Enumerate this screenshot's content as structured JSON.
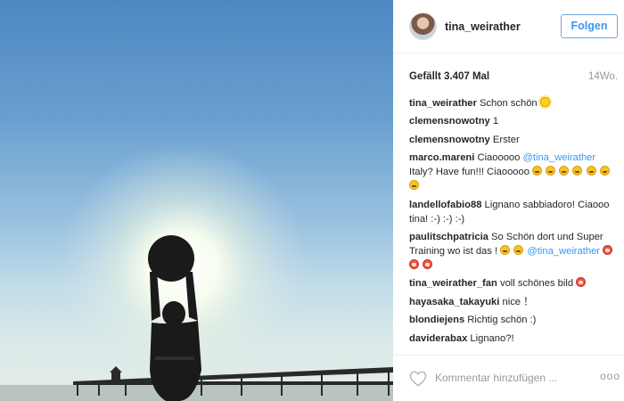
{
  "post": {
    "username": "tina_weirather",
    "follow_label": "Folgen",
    "likes_text": "Gefällt 3.407 Mal",
    "time_text": "14Wo."
  },
  "comments": [
    {
      "user": "tina_weirather",
      "text": "Schon schön"
    },
    {
      "user": "clemensnowotny",
      "text": "1"
    },
    {
      "user": "clemensnowotny",
      "text": "Erster"
    },
    {
      "user": "marco.mareni",
      "text": "Ciaooooo",
      "mention": "@tina_weirather",
      "text2": "Italy? Have fun!!! Ciaooooo"
    },
    {
      "user": "landellofabio88",
      "text": "Lignano sabbiadoro! Ciaooo tina! :-) :-) :-)"
    },
    {
      "user": "paulitschpatricia",
      "text": "So Schön dort und Super Training wo ist das !",
      "mention": "@tina_weirather"
    },
    {
      "user": "tina_weirather_fan",
      "text": "voll schönes bild"
    },
    {
      "user": "hayasaka_takayuki",
      "text": "nice ！"
    },
    {
      "user": "blondiejens",
      "text": "Richtig schön :)"
    },
    {
      "user": "daviderabax",
      "text": "Lignano?!"
    }
  ],
  "footer": {
    "add_comment_placeholder": "Kommentar hinzufügen ...",
    "more_label": "ooo"
  },
  "icons": {
    "like": "heart-outline-icon",
    "more": "more-options-icon",
    "emoji_sun": "sun-emoji-icon",
    "emoji_face": "smiley-emoji-icon",
    "emoji_heart": "heart-eyes-emoji-icon"
  },
  "colors": {
    "link": "#3897f0",
    "follow_border": "#6fa8dc",
    "muted": "#999999"
  }
}
